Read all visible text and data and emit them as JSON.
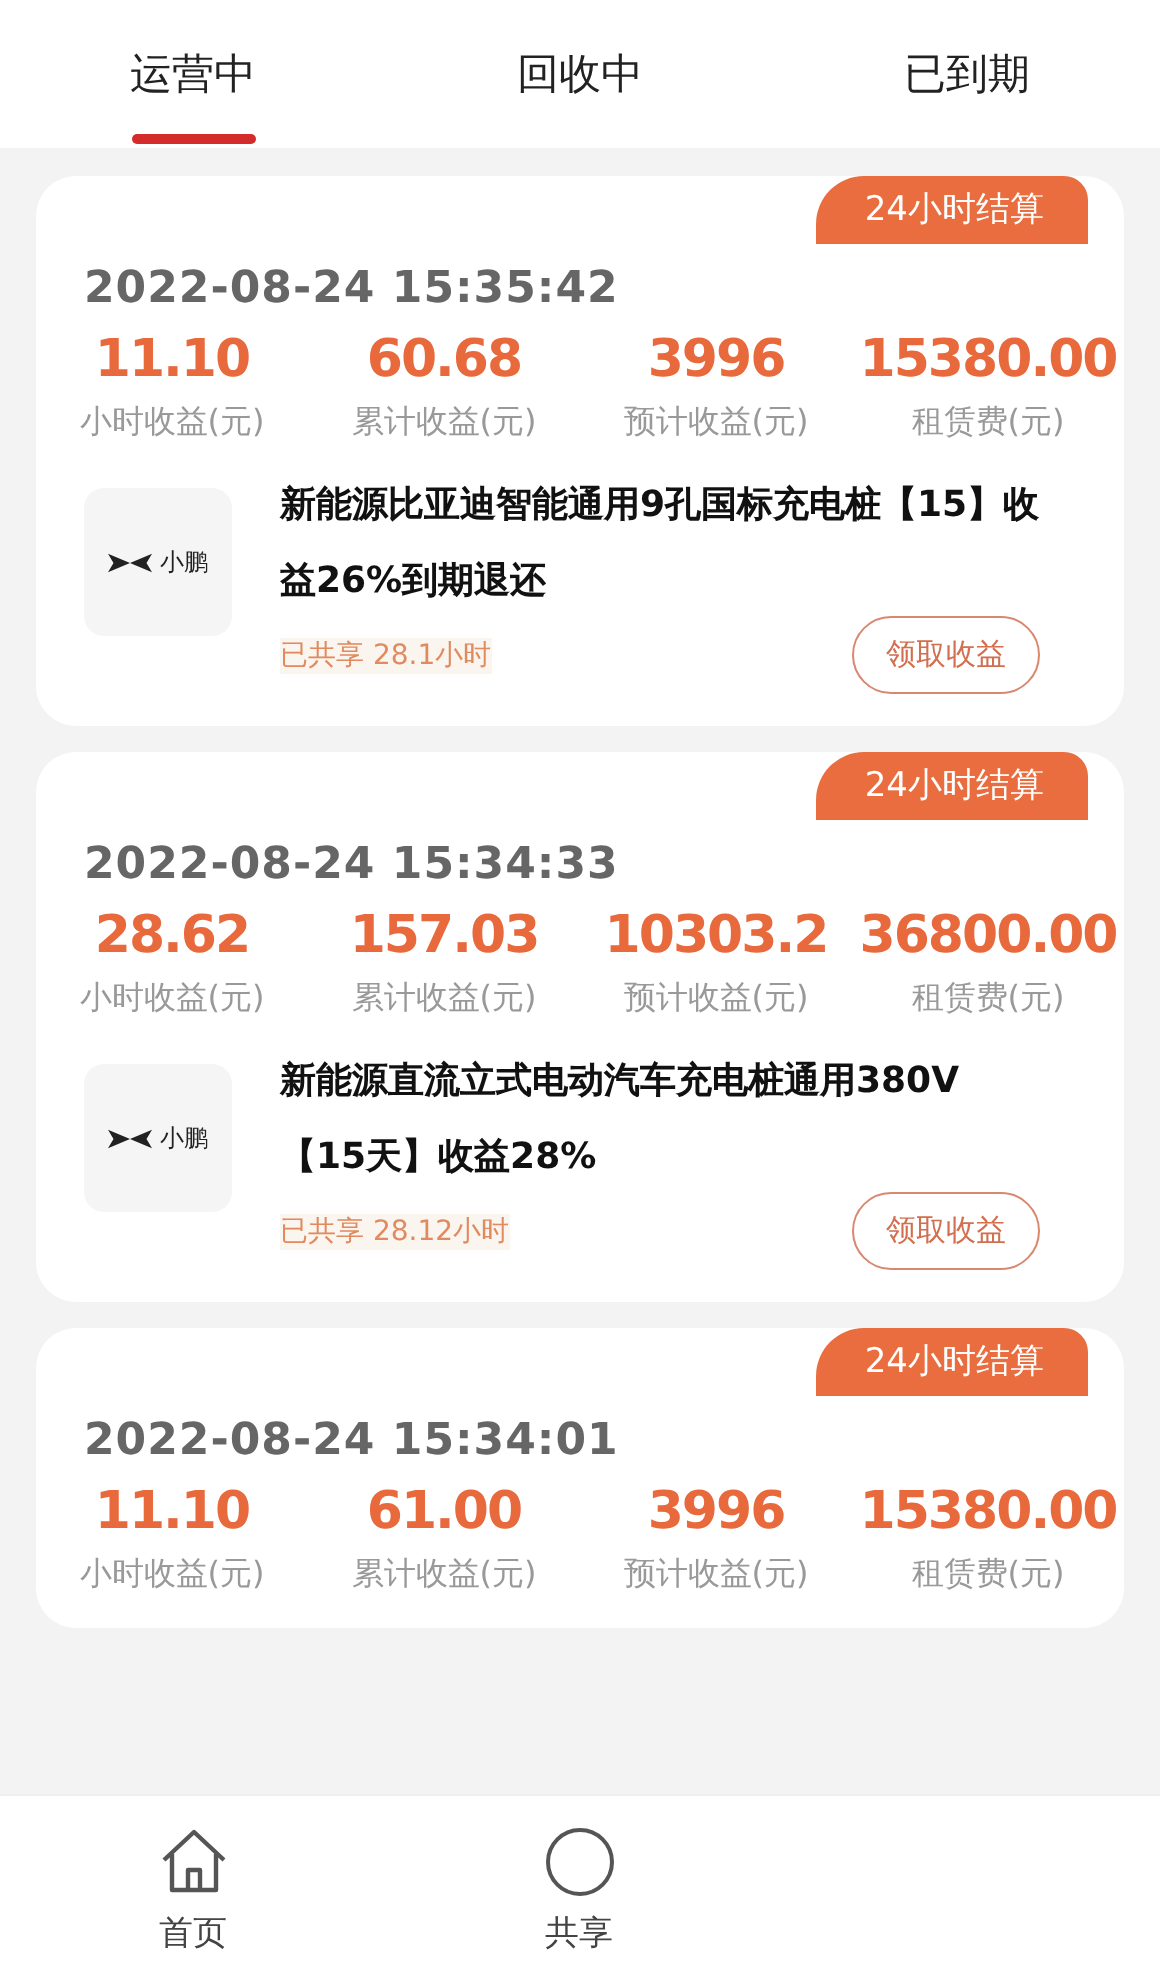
{
  "tabs": [
    {
      "label": "运营中",
      "selected": true
    },
    {
      "label": "回收中",
      "selected": false
    },
    {
      "label": "已到期",
      "selected": false
    }
  ],
  "cards": [
    {
      "badge": "24小时结算",
      "time": "2022-08-24 15:35:42",
      "metrics": [
        {
          "value": "11.10",
          "label": "小时收益(元)"
        },
        {
          "value": "60.68",
          "label": "累计收益(元)"
        },
        {
          "value": "3996",
          "label": "预计收益(元)"
        },
        {
          "value": "15380.00",
          "label": "租赁费(元)"
        }
      ],
      "product": {
        "logo_text": "小鹏",
        "title": "新能源比亚迪智能通用9孔国标充电桩【15】收益26%到期退还",
        "shared": "已共享 28.1小时",
        "button": "领取收益"
      }
    },
    {
      "badge": "24小时结算",
      "time": "2022-08-24 15:34:33",
      "metrics": [
        {
          "value": "28.62",
          "label": "小时收益(元)"
        },
        {
          "value": "157.03",
          "label": "累计收益(元)"
        },
        {
          "value": "10303.2",
          "label": "预计收益(元)"
        },
        {
          "value": "36800.00",
          "label": "租赁费(元)"
        }
      ],
      "product": {
        "logo_text": "小鹏",
        "title": "新能源直流立式电动汽车充电桩通用380V【15天】收益28%",
        "shared": "已共享 28.12小时",
        "button": "领取收益"
      }
    },
    {
      "badge": "24小时结算",
      "time": "2022-08-24 15:34:01",
      "metrics": [
        {
          "value": "11.10",
          "label": "小时收益(元)"
        },
        {
          "value": "61.00",
          "label": "累计收益(元)"
        },
        {
          "value": "3996",
          "label": "预计收益(元)"
        },
        {
          "value": "15380.00",
          "label": "租赁费(元)"
        }
      ]
    }
  ],
  "bottom_nav": [
    {
      "kind": "home",
      "label": "首页"
    },
    {
      "kind": "share",
      "label": "共享"
    }
  ]
}
